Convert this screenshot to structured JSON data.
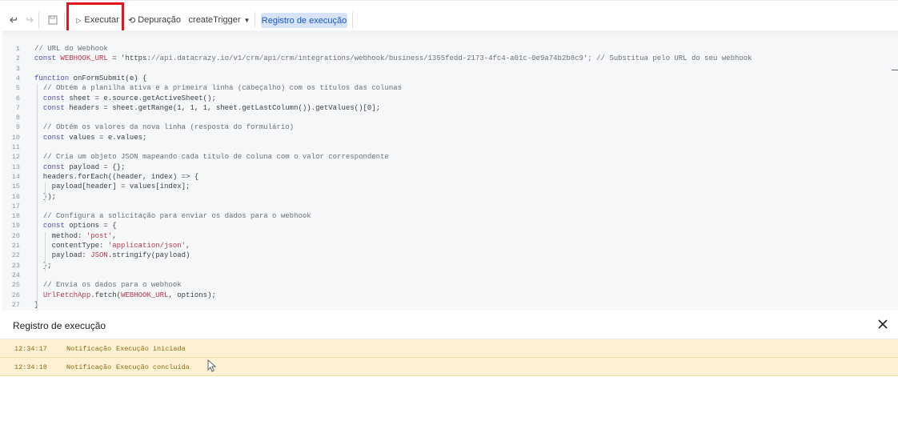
{
  "toolbar": {
    "undo_icon": "undo-icon",
    "redo_icon": "redo-icon",
    "save_icon": "save-icon",
    "run_label": "Executar",
    "debug_label": "Depuração",
    "function_selected": "createTrigger",
    "execution_log_label": "Registro de execução",
    "highlight_color": "#e3161c"
  },
  "editor": {
    "lines": [
      {
        "n": "1",
        "text": "// URL do Webhook"
      },
      {
        "n": "2",
        "text": "const WEBHOOK_URL = 'https://api.datacrazy.io/v1/crm/api/crm/integrations/webhook/business/1355fedd-2173-4fc4-a01c-0e9a74b2b8c9'; // Substitua pelo URL do seu webhook"
      },
      {
        "n": "3",
        "text": ""
      },
      {
        "n": "4",
        "text": "function onFormSubmit(e) {"
      },
      {
        "n": "5",
        "text": "  // Obtém a planilha ativa e a primeira linha (cabeçalho) com os títulos das colunas"
      },
      {
        "n": "6",
        "text": "  const sheet = e.source.getActiveSheet();"
      },
      {
        "n": "7",
        "text": "  const headers = sheet.getRange(1, 1, 1, sheet.getLastColumn()).getValues()[0];"
      },
      {
        "n": "8",
        "text": ""
      },
      {
        "n": "9",
        "text": "  // Obtém os valores da nova linha (resposta do formulário)"
      },
      {
        "n": "10",
        "text": "  const values = e.values;"
      },
      {
        "n": "11",
        "text": ""
      },
      {
        "n": "12",
        "text": "  // Cria um objeto JSON mapeando cada título de coluna com o valor correspondente"
      },
      {
        "n": "13",
        "text": "  const payload = {};"
      },
      {
        "n": "14",
        "text": "  headers.forEach((header, index) => {"
      },
      {
        "n": "15",
        "text": "    payload[header] = values[index];"
      },
      {
        "n": "16",
        "text": "  });"
      },
      {
        "n": "17",
        "text": ""
      },
      {
        "n": "18",
        "text": "  // Configura a solicitação para enviar os dados para o webhook"
      },
      {
        "n": "19",
        "text": "  const options = {"
      },
      {
        "n": "20",
        "text": "    method: 'post',"
      },
      {
        "n": "21",
        "text": "    contentType: 'application/json',"
      },
      {
        "n": "22",
        "text": "    payload: JSON.stringify(payload)"
      },
      {
        "n": "23",
        "text": "  };"
      },
      {
        "n": "24",
        "text": ""
      },
      {
        "n": "25",
        "text": "  // Envia os dados para o webhook"
      },
      {
        "n": "26",
        "text": "  UrlFetchApp.fetch(WEBHOOK_URL, options);"
      },
      {
        "n": "27",
        "text": "}"
      }
    ]
  },
  "log": {
    "title": "Registro de execução",
    "close_icon": "close-icon",
    "rows": [
      {
        "time": "12:34:17",
        "level": "Notificação",
        "message": "Execução iniciada"
      },
      {
        "time": "12:34:18",
        "level": "Notificação",
        "message": "Execução concluída"
      }
    ]
  }
}
